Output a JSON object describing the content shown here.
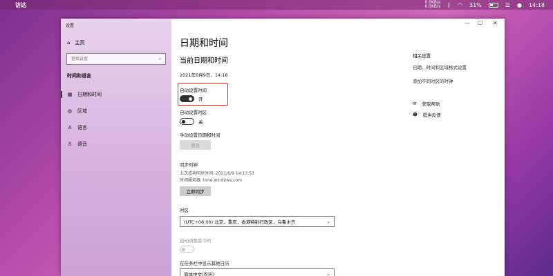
{
  "menubar": {
    "app_name": "访达",
    "net_up": "0.0KB/s",
    "net_down": "0.0KB/s",
    "battery": "31%",
    "clock": "14:18"
  },
  "window": {
    "title": "设置",
    "controls": {
      "minimize": "—",
      "maximize": "☐",
      "close": "✕"
    }
  },
  "sidebar": {
    "home": "主页",
    "search_placeholder": "查找设置",
    "section": "时间和语言",
    "items": [
      {
        "label": "日期和时间",
        "icon": "calendar-icon",
        "active": true
      },
      {
        "label": "区域",
        "icon": "globe-icon",
        "active": false
      },
      {
        "label": "语言",
        "icon": "language-icon",
        "active": false
      },
      {
        "label": "语音",
        "icon": "microphone-icon",
        "active": false
      }
    ]
  },
  "main": {
    "page_title": "日期和时间",
    "sub_title": "当前日期和时间",
    "current_datetime": "2021年6月9日，14:18",
    "auto_time": {
      "label": "自动设置时间",
      "state": "开"
    },
    "auto_timezone": {
      "label": "自动设置时区",
      "state": "关"
    },
    "manual": {
      "label": "手动设置日期和时间",
      "button": "更改"
    },
    "sync": {
      "heading": "同步时钟",
      "last_sync": "上次成功同步时间: 2021/6/9 14:13:53",
      "server": "时间服务器: time.windows.com",
      "button": "立即同步"
    },
    "timezone": {
      "label": "时区",
      "value": "(UTC+08:00) 北京，重庆，香港特别行政区，乌鲁木齐"
    },
    "dst": {
      "label": "自动调整夏令时"
    },
    "calendar": {
      "label": "在任务栏中显示其他日历",
      "value": "简体中文(农历)"
    }
  },
  "related": {
    "title": "相关设置",
    "links": [
      "日期、时间和区域格式设置",
      "添加不同时区的时钟"
    ],
    "help": "获取帮助",
    "feedback": "提供反馈"
  },
  "colors": {
    "highlight_border": "#d9342b",
    "toggle_on": "#2f2f2f"
  }
}
